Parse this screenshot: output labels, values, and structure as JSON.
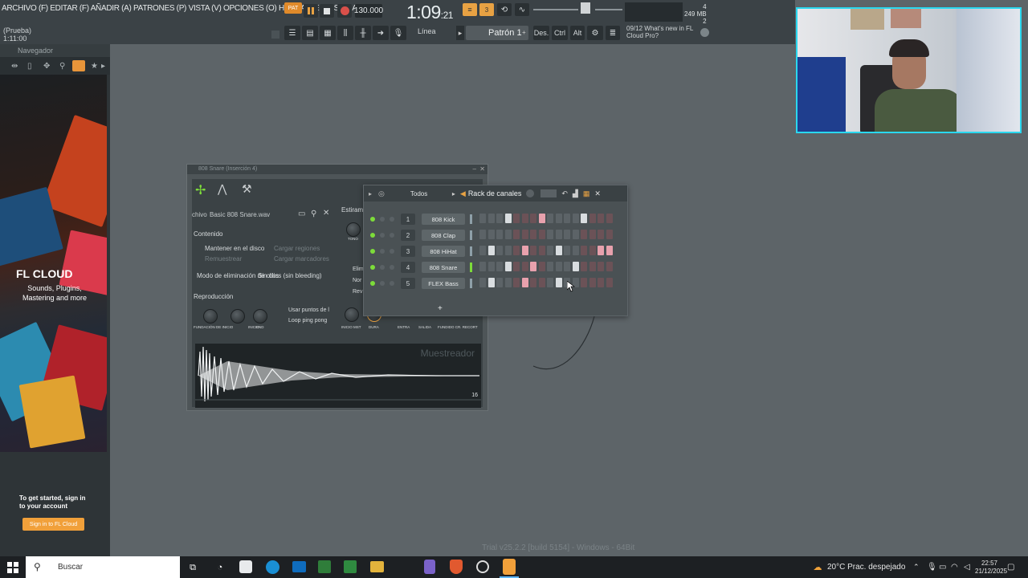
{
  "menu": {
    "text": "ARCHIVO (F) EDITAR (F) AÑADIR (A) PATRONES (P) VISTA (V) OPCIONES (O) HERRAMIENTAS (T) AYUDA"
  },
  "hint": {
    "line1": "(Prueba)",
    "line2": "1:11:00"
  },
  "transport": {
    "bpm": "130.000",
    "time_main": "1:09",
    "time_frac": ":21",
    "mode_label": "PAT"
  },
  "toolbar": {
    "snap_label": "Línea",
    "pattern_label": "Patrón 1",
    "des_label": "Des.",
    "ctrl_label": "Ctrl",
    "alt_label": "Alt"
  },
  "news": {
    "date": "09/12",
    "text": "What's new in FL Cloud Pro?"
  },
  "memory": {
    "line1": "4",
    "line2": "249 MB",
    "line3": "2"
  },
  "browser": {
    "title": "Navegador",
    "promo_title": "FL CLOUD",
    "promo_sub": "Sounds, Plugins, Mastering and more",
    "signin_text_1": "To get started, sign in",
    "signin_text_2": "to your account",
    "signin_button": "Sign in to FL Cloud"
  },
  "sampler": {
    "title": "808 Snare",
    "title_sub": "(Inserción 4)",
    "file_label": "chivo",
    "file_name": "Basic 808 Snare.wav",
    "section_content": "Contenido",
    "keep_disk": "Mantener en el disco",
    "load_regions": "Cargar regiones",
    "resample": "Remuestrear",
    "load_markers": "Cargar marcadores",
    "declick_mode": "Modo de eliminación de clics",
    "declick_value": "Sin clics (sin bleeding)",
    "estirar": "Estiram",
    "section_playback": "Reproducción",
    "use_loop_points": "Usar puntos de l",
    "loop_pingpong": "Loop ping pong",
    "knob_labels": [
      "FUNDACIÓN DE INICIO",
      "INICIO",
      "END"
    ],
    "knob_labels_right": [
      "INICIO MST",
      "DURA",
      "ENTRA",
      "SALIDA",
      "FUNDIDO CR. RECORT"
    ],
    "elim": "Elim",
    "nor": "Nor",
    "rev": "Rev",
    "tono": "TONO",
    "watermark": "Muestreador",
    "wave_tag": "16"
  },
  "rack": {
    "filter": "Todos",
    "title": "Rack de canales",
    "channels": [
      {
        "num": "1",
        "name": "808 Kick",
        "steps": [
          0,
          0,
          0,
          1,
          0,
          0,
          0,
          2,
          0,
          0,
          0,
          0,
          1,
          0,
          0,
          0
        ]
      },
      {
        "num": "2",
        "name": "808 Clap",
        "steps": [
          0,
          0,
          0,
          0,
          0,
          0,
          0,
          0,
          0,
          0,
          0,
          0,
          0,
          0,
          0,
          0
        ]
      },
      {
        "num": "3",
        "name": "808 HiHat",
        "steps": [
          0,
          1,
          0,
          0,
          0,
          2,
          0,
          0,
          0,
          1,
          0,
          0,
          0,
          0,
          2,
          2
        ]
      },
      {
        "num": "4",
        "name": "808 Snare",
        "steps": [
          0,
          0,
          0,
          1,
          0,
          0,
          2,
          0,
          0,
          0,
          0,
          1,
          0,
          0,
          0,
          0
        ]
      },
      {
        "num": "5",
        "name": "FLEX Bass",
        "steps": [
          0,
          1,
          0,
          0,
          0,
          2,
          0,
          0,
          0,
          1,
          0,
          0,
          0,
          0,
          0,
          0
        ]
      }
    ]
  },
  "trial": "Trial v25.2.2 [build 5154] - Windows - 64Bit",
  "taskbar": {
    "search": "Buscar",
    "weather": "20°C  Prac. despejado",
    "time": "22:57",
    "date": "21/12/2025"
  },
  "colors": {
    "accent_green": "#7ddc3a",
    "step_off": "#6a5358",
    "step_pink": "#e8a1ad",
    "step_white": "#d9dde0",
    "orange": "#f1a03a",
    "cam_border": "#2ad8ef"
  }
}
